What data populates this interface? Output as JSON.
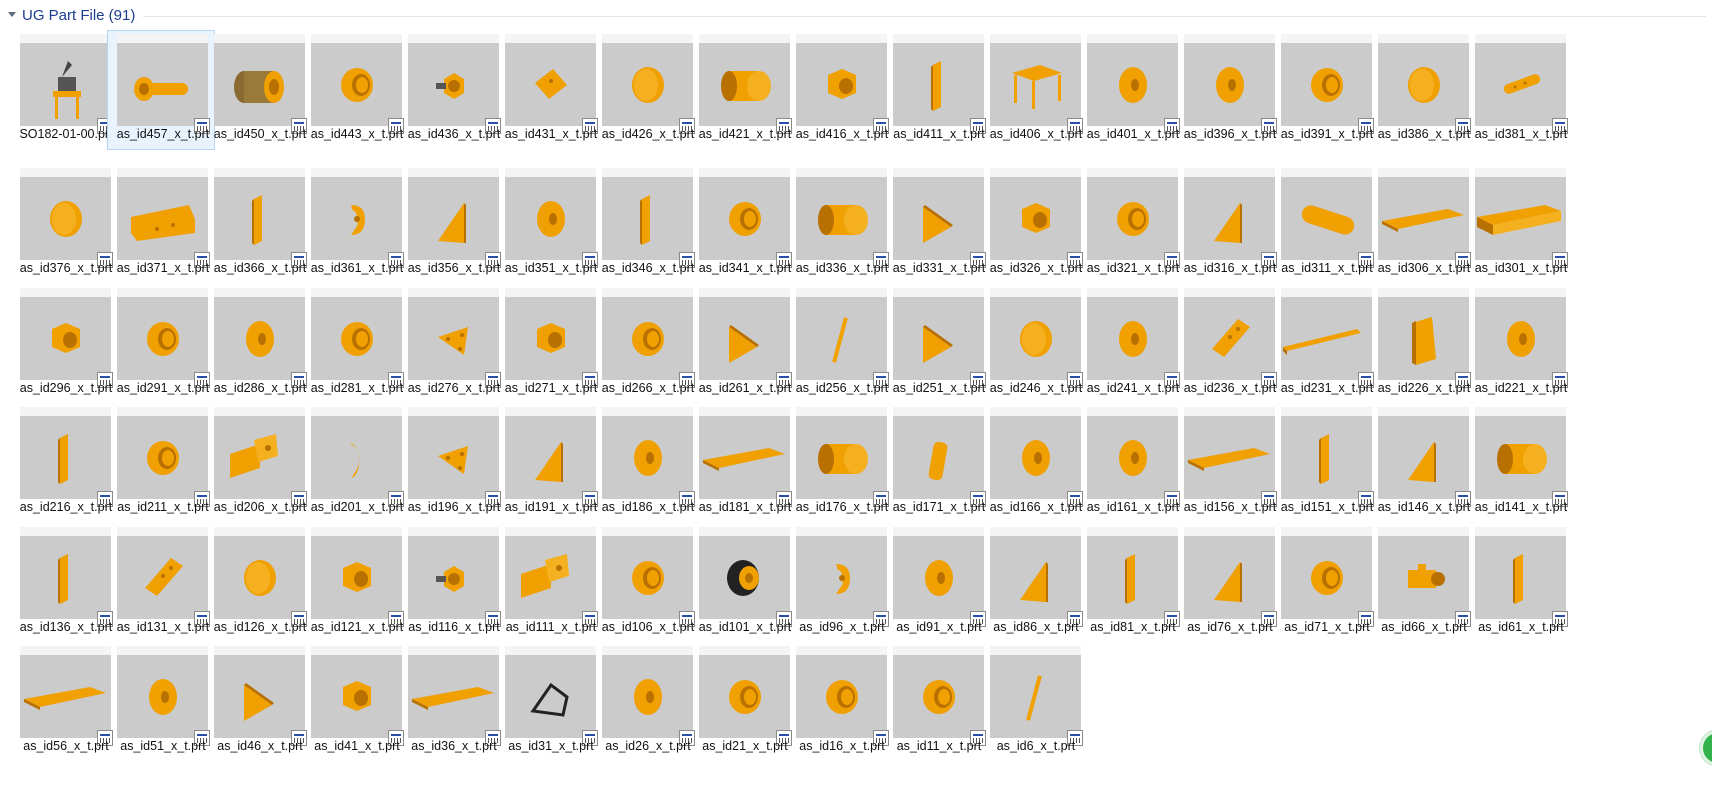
{
  "group": {
    "title": "UG Part File (91)"
  },
  "selected_index": 1,
  "badge": {
    "label": "1"
  },
  "colors": {
    "part": "#f0a000",
    "part_dark": "#b87000",
    "thumb_bg": "#cbcbcb",
    "header_text": "#1e3e8f"
  },
  "files": [
    {
      "name": "SO182-01-00.prt",
      "shape": "assembly"
    },
    {
      "name": "as_id457_x_t.prt",
      "shape": "bolt"
    },
    {
      "name": "as_id450_x_t.prt",
      "shape": "drum-dark"
    },
    {
      "name": "as_id443_x_t.prt",
      "shape": "ring"
    },
    {
      "name": "as_id436_x_t.prt",
      "shape": "knob"
    },
    {
      "name": "as_id431_x_t.prt",
      "shape": "square-plate"
    },
    {
      "name": "as_id426_x_t.prt",
      "shape": "disc"
    },
    {
      "name": "as_id421_x_t.prt",
      "shape": "cylinder"
    },
    {
      "name": "as_id416_x_t.prt",
      "shape": "nut"
    },
    {
      "name": "as_id411_x_t.prt",
      "shape": "strip"
    },
    {
      "name": "as_id406_x_t.prt",
      "shape": "table"
    },
    {
      "name": "as_id401_x_t.prt",
      "shape": "washer"
    },
    {
      "name": "as_id396_x_t.prt",
      "shape": "washer"
    },
    {
      "name": "as_id391_x_t.prt",
      "shape": "ring"
    },
    {
      "name": "as_id386_x_t.prt",
      "shape": "disc"
    },
    {
      "name": "as_id381_x_t.prt",
      "shape": "rod-holes"
    },
    {
      "name": "as_id376_x_t.prt",
      "shape": "disc"
    },
    {
      "name": "as_id371_x_t.prt",
      "shape": "bracket-long"
    },
    {
      "name": "as_id366_x_t.prt",
      "shape": "strip"
    },
    {
      "name": "as_id361_x_t.prt",
      "shape": "clamp"
    },
    {
      "name": "as_id356_x_t.prt",
      "shape": "wedge"
    },
    {
      "name": "as_id351_x_t.prt",
      "shape": "washer"
    },
    {
      "name": "as_id346_x_t.prt",
      "shape": "strip"
    },
    {
      "name": "as_id341_x_t.prt",
      "shape": "ring"
    },
    {
      "name": "as_id336_x_t.prt",
      "shape": "cylinder"
    },
    {
      "name": "as_id331_x_t.prt",
      "shape": "triangle"
    },
    {
      "name": "as_id326_x_t.prt",
      "shape": "nut"
    },
    {
      "name": "as_id321_x_t.prt",
      "shape": "ring"
    },
    {
      "name": "as_id316_x_t.prt",
      "shape": "wedge"
    },
    {
      "name": "as_id311_x_t.prt",
      "shape": "long-cylinder"
    },
    {
      "name": "as_id306_x_t.prt",
      "shape": "plate"
    },
    {
      "name": "as_id301_x_t.prt",
      "shape": "channel"
    },
    {
      "name": "as_id296_x_t.prt",
      "shape": "nut"
    },
    {
      "name": "as_id291_x_t.prt",
      "shape": "ring"
    },
    {
      "name": "as_id286_x_t.prt",
      "shape": "washer"
    },
    {
      "name": "as_id281_x_t.prt",
      "shape": "ring"
    },
    {
      "name": "as_id276_x_t.prt",
      "shape": "tri-plate"
    },
    {
      "name": "as_id271_x_t.prt",
      "shape": "nut"
    },
    {
      "name": "as_id266_x_t.prt",
      "shape": "ring"
    },
    {
      "name": "as_id261_x_t.prt",
      "shape": "triangle"
    },
    {
      "name": "as_id256_x_t.prt",
      "shape": "pin"
    },
    {
      "name": "as_id251_x_t.prt",
      "shape": "triangle"
    },
    {
      "name": "as_id246_x_t.prt",
      "shape": "disc"
    },
    {
      "name": "as_id241_x_t.prt",
      "shape": "washer"
    },
    {
      "name": "as_id236_x_t.prt",
      "shape": "slab"
    },
    {
      "name": "as_id231_x_t.prt",
      "shape": "bar"
    },
    {
      "name": "as_id226_x_t.prt",
      "shape": "block"
    },
    {
      "name": "as_id221_x_t.prt",
      "shape": "washer"
    },
    {
      "name": "as_id216_x_t.prt",
      "shape": "strip"
    },
    {
      "name": "as_id211_x_t.prt",
      "shape": "ring"
    },
    {
      "name": "as_id206_x_t.prt",
      "shape": "angle"
    },
    {
      "name": "as_id201_x_t.prt",
      "shape": "arc"
    },
    {
      "name": "as_id196_x_t.prt",
      "shape": "tri-plate"
    },
    {
      "name": "as_id191_x_t.prt",
      "shape": "wedge"
    },
    {
      "name": "as_id186_x_t.prt",
      "shape": "washer"
    },
    {
      "name": "as_id181_x_t.prt",
      "shape": "plate"
    },
    {
      "name": "as_id176_x_t.prt",
      "shape": "cylinder"
    },
    {
      "name": "as_id171_x_t.prt",
      "shape": "post"
    },
    {
      "name": "as_id166_x_t.prt",
      "shape": "washer"
    },
    {
      "name": "as_id161_x_t.prt",
      "shape": "washer"
    },
    {
      "name": "as_id156_x_t.prt",
      "shape": "plate"
    },
    {
      "name": "as_id151_x_t.prt",
      "shape": "strip"
    },
    {
      "name": "as_id146_x_t.prt",
      "shape": "wedge"
    },
    {
      "name": "as_id141_x_t.prt",
      "shape": "cylinder"
    },
    {
      "name": "as_id136_x_t.prt",
      "shape": "strip"
    },
    {
      "name": "as_id131_x_t.prt",
      "shape": "slab"
    },
    {
      "name": "as_id126_x_t.prt",
      "shape": "disc"
    },
    {
      "name": "as_id121_x_t.prt",
      "shape": "nut"
    },
    {
      "name": "as_id116_x_t.prt",
      "shape": "knob"
    },
    {
      "name": "as_id111_x_t.prt",
      "shape": "angle"
    },
    {
      "name": "as_id106_x_t.prt",
      "shape": "ring"
    },
    {
      "name": "as_id101_x_t.prt",
      "shape": "wheel"
    },
    {
      "name": "as_id96_x_t.prt",
      "shape": "clamp"
    },
    {
      "name": "as_id91_x_t.prt",
      "shape": "washer"
    },
    {
      "name": "as_id86_x_t.prt",
      "shape": "wedge"
    },
    {
      "name": "as_id81_x_t.prt",
      "shape": "strip"
    },
    {
      "name": "as_id76_x_t.prt",
      "shape": "wedge"
    },
    {
      "name": "as_id71_x_t.prt",
      "shape": "ring"
    },
    {
      "name": "as_id66_x_t.prt",
      "shape": "motor"
    },
    {
      "name": "as_id61_x_t.prt",
      "shape": "strip"
    },
    {
      "name": "as_id56_x_t.prt",
      "shape": "plate"
    },
    {
      "name": "as_id51_x_t.prt",
      "shape": "washer"
    },
    {
      "name": "as_id46_x_t.prt",
      "shape": "triangle"
    },
    {
      "name": "as_id41_x_t.prt",
      "shape": "nut"
    },
    {
      "name": "as_id36_x_t.prt",
      "shape": "plate"
    },
    {
      "name": "as_id31_x_t.prt",
      "shape": "frame"
    },
    {
      "name": "as_id26_x_t.prt",
      "shape": "washer"
    },
    {
      "name": "as_id21_x_t.prt",
      "shape": "ring"
    },
    {
      "name": "as_id16_x_t.prt",
      "shape": "ring"
    },
    {
      "name": "as_id11_x_t.prt",
      "shape": "ring"
    },
    {
      "name": "as_id6_x_t.prt",
      "shape": "pin"
    }
  ]
}
